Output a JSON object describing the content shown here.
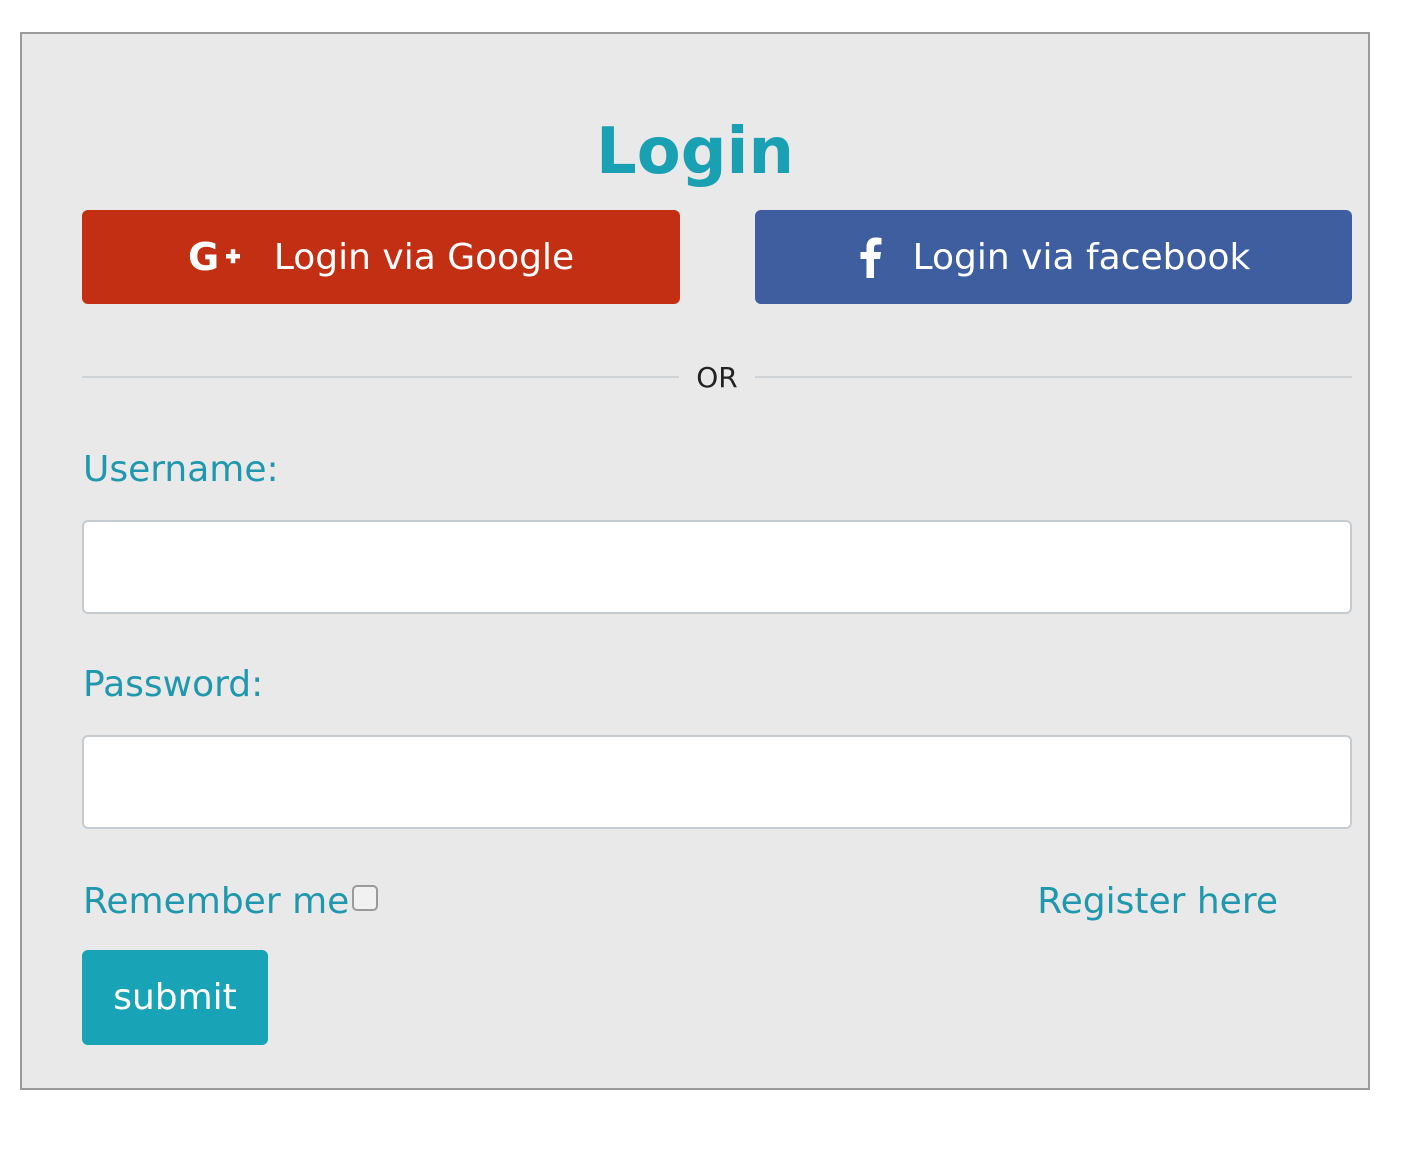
{
  "form": {
    "title": "Login",
    "social": {
      "google": {
        "label": "Login via Google",
        "icon": "google-plus-icon",
        "color": "#c22f13"
      },
      "facebook": {
        "label": "Login via facebook",
        "icon": "facebook-icon",
        "color": "#3f5e9f"
      }
    },
    "divider_text": "OR",
    "username": {
      "label": "Username:",
      "value": "",
      "placeholder": ""
    },
    "password": {
      "label": "Password:",
      "value": "",
      "placeholder": ""
    },
    "remember_me": {
      "label": "Remember me",
      "checked": false
    },
    "register_link": "Register here",
    "submit_label": "submit"
  },
  "colors": {
    "accent": "#1aa0b3",
    "background": "#e9e9ea",
    "border": "#9b9b9b"
  }
}
